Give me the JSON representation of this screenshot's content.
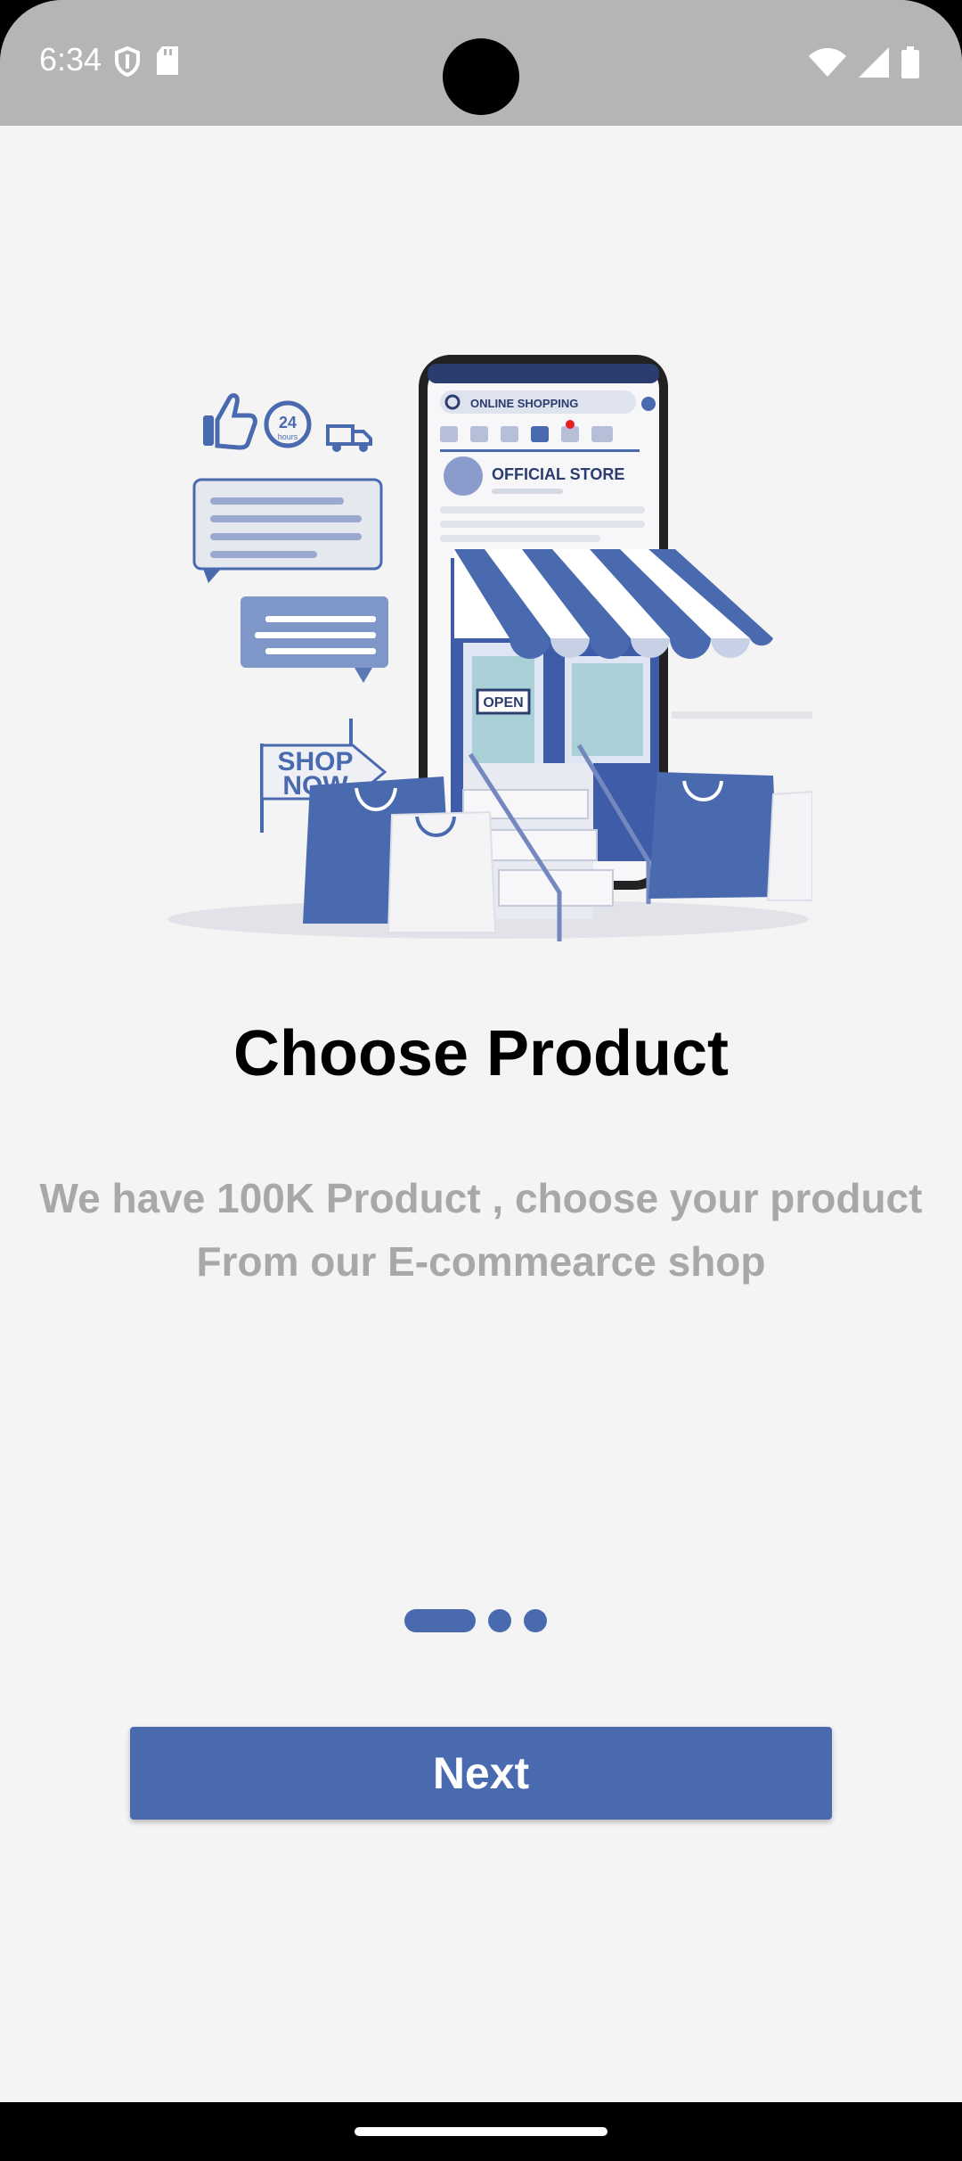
{
  "status_bar": {
    "time": "6:34",
    "icons_left": [
      "shield-icon",
      "sd-card-icon"
    ],
    "icons_right": [
      "wifi-icon",
      "signal-icon",
      "battery-icon"
    ]
  },
  "illustration": {
    "search_text": "ONLINE SHOPPING",
    "store_label": "OFFICIAL STORE",
    "open_sign": "OPEN",
    "shop_now_line1": "SHOP",
    "shop_now_line2": "NOW",
    "badge_24": "24",
    "badge_hours": "hours"
  },
  "onboarding": {
    "title": "Choose Product",
    "subtitle_line1": "We have 100K Product , choose your product",
    "subtitle_line2": "From our E-commearce shop",
    "page_count": 3,
    "current_page": 1,
    "next_label": "Next"
  },
  "colors": {
    "accent": "#4a6ab0",
    "status_bar": "#b5b5b5",
    "background": "#f4f4f4",
    "subtitle": "#a8a8a8"
  }
}
